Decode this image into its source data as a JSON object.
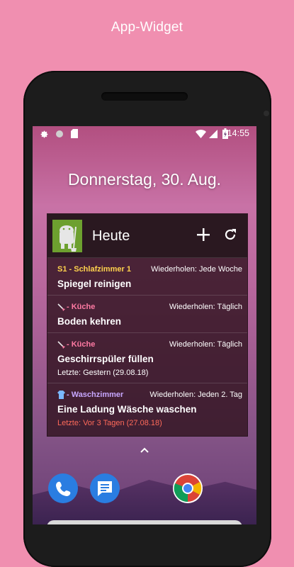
{
  "caption": "App-Widget",
  "status_bar": {
    "time": "14:55"
  },
  "date_text": "Donnerstag, 30. Aug.",
  "widget": {
    "title": "Heute",
    "tasks": [
      {
        "room": "S1 - Schlafzimmer 1",
        "room_color": "#ffd24d",
        "repeat": "Wiederholen: Jede Woche",
        "name": "Spiegel reinigen",
        "last": ""
      },
      {
        "room": "- Küche",
        "room_color": "#ff7aa3",
        "repeat": "Wiederholen: Täglich",
        "name": "Boden kehren",
        "last": ""
      },
      {
        "room": "- Küche",
        "room_color": "#ff7aa3",
        "repeat": "Wiederholen: Täglich",
        "name": "Geschirrspüler füllen",
        "last": "Letzte: Gestern (29.08.18)"
      },
      {
        "room": "- Waschzimmer",
        "room_color": "#c8a7ff",
        "repeat": "Wiederholen: Jeden 2. Tag",
        "name": "Eine Ladung Wäsche waschen",
        "last": "Letzte: Vor 3 Tagen (27.08.18)"
      }
    ]
  },
  "colors": {
    "background": "#f08fb0",
    "overdue": "#ff6a5a",
    "widget_icon": "#6da02f"
  }
}
